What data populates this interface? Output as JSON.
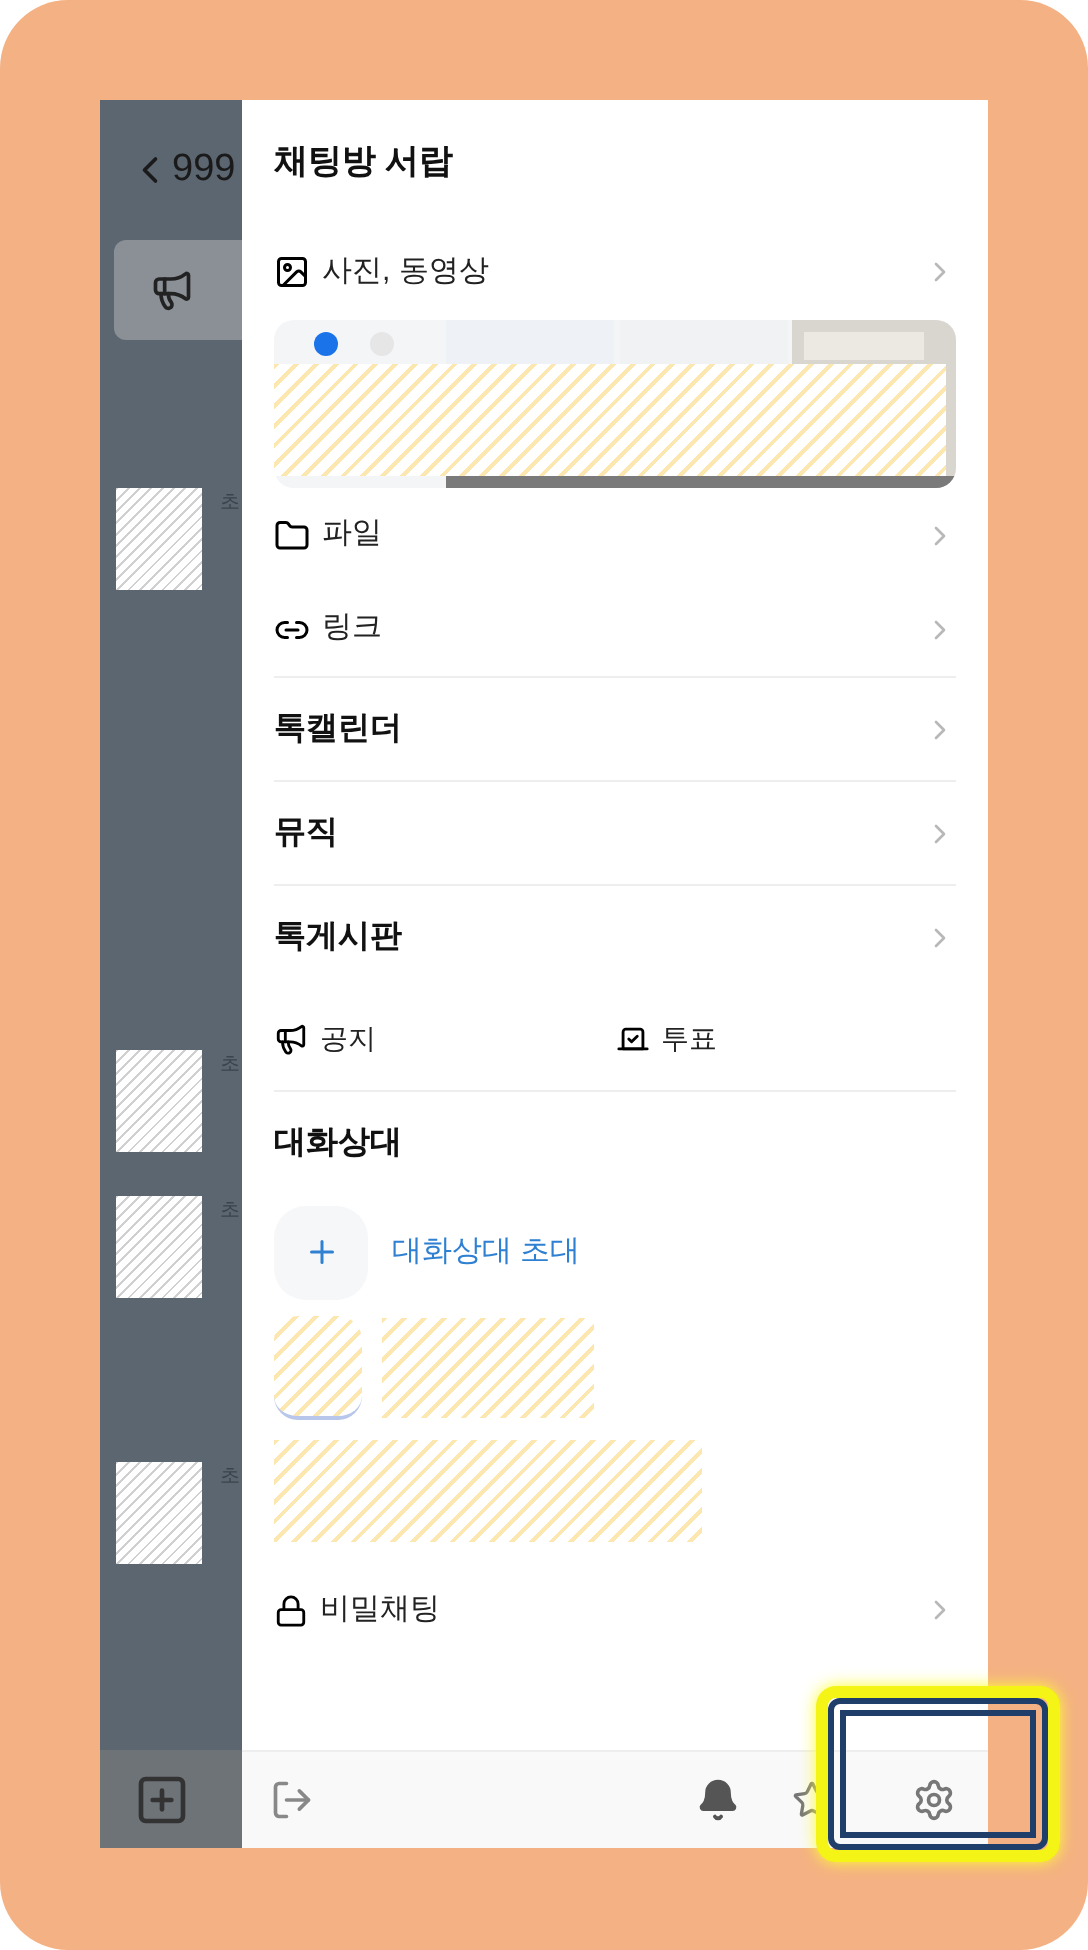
{
  "chat_background": {
    "back_label": "999",
    "sender_names": [
      "초",
      "초",
      "초",
      "초"
    ]
  },
  "drawer": {
    "title": "채팅방 서랍",
    "rows": [
      {
        "kind": "media",
        "label": "사진, 동영상"
      },
      {
        "kind": "file",
        "label": "파일"
      },
      {
        "kind": "link",
        "label": "링크"
      },
      {
        "kind": "feature",
        "label": "톡캘린더"
      },
      {
        "kind": "feature",
        "label": "뮤직"
      },
      {
        "kind": "feature",
        "label": "톡게시판"
      },
      {
        "kind": "pair",
        "label": "공지",
        "second_label": "투표"
      },
      {
        "kind": "heading",
        "label": "대화상대"
      },
      {
        "kind": "invite",
        "label": "대화상대 초대"
      },
      {
        "kind": "members"
      },
      {
        "kind": "secret",
        "label": "비밀채팅"
      }
    ]
  }
}
